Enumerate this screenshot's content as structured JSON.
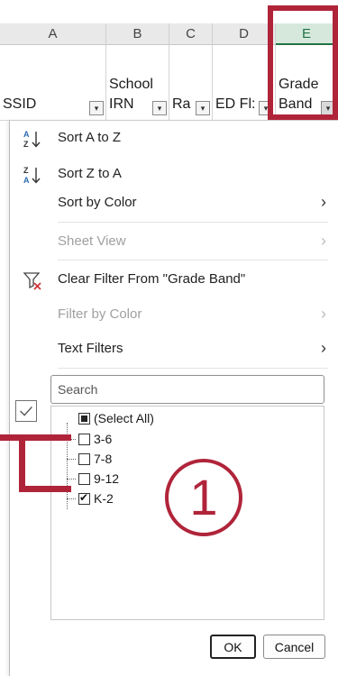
{
  "columns": {
    "letters": [
      "A",
      "B",
      "C",
      "D",
      "E"
    ],
    "headers": [
      {
        "line1": "",
        "line2": "SSID"
      },
      {
        "line1": "School",
        "line2": "IRN"
      },
      {
        "line1": "",
        "line2": "Ra"
      },
      {
        "line1": "",
        "line2": "ED Fl:"
      },
      {
        "line1": "Grade",
        "line2": "Band"
      }
    ]
  },
  "menu": {
    "sort_az": "Sort A to Z",
    "sort_za": "Sort Z to A",
    "sort_by_color": "Sort by Color",
    "sheet_view": "Sheet View",
    "clear_filter": "Clear Filter From \"Grade Band\"",
    "filter_by_color": "Filter by Color",
    "text_filters": "Text Filters",
    "submenu_arrow": "›"
  },
  "search": {
    "placeholder": "Search"
  },
  "list": [
    {
      "label": "(Select All)",
      "state": "partial"
    },
    {
      "label": "3-6",
      "state": "unchecked"
    },
    {
      "label": "7-8",
      "state": "unchecked"
    },
    {
      "label": "9-12",
      "state": "unchecked"
    },
    {
      "label": "K-2",
      "state": "checked"
    }
  ],
  "buttons": {
    "ok": "OK",
    "cancel": "Cancel"
  },
  "annotation": {
    "step_number": "1",
    "color": "#b0243a"
  },
  "icons": {
    "sort_az": "sort-ascending-icon",
    "sort_za": "sort-descending-icon",
    "clear_filter": "clear-filter-icon",
    "filter_dropdown": "filter-dropdown-icon"
  }
}
